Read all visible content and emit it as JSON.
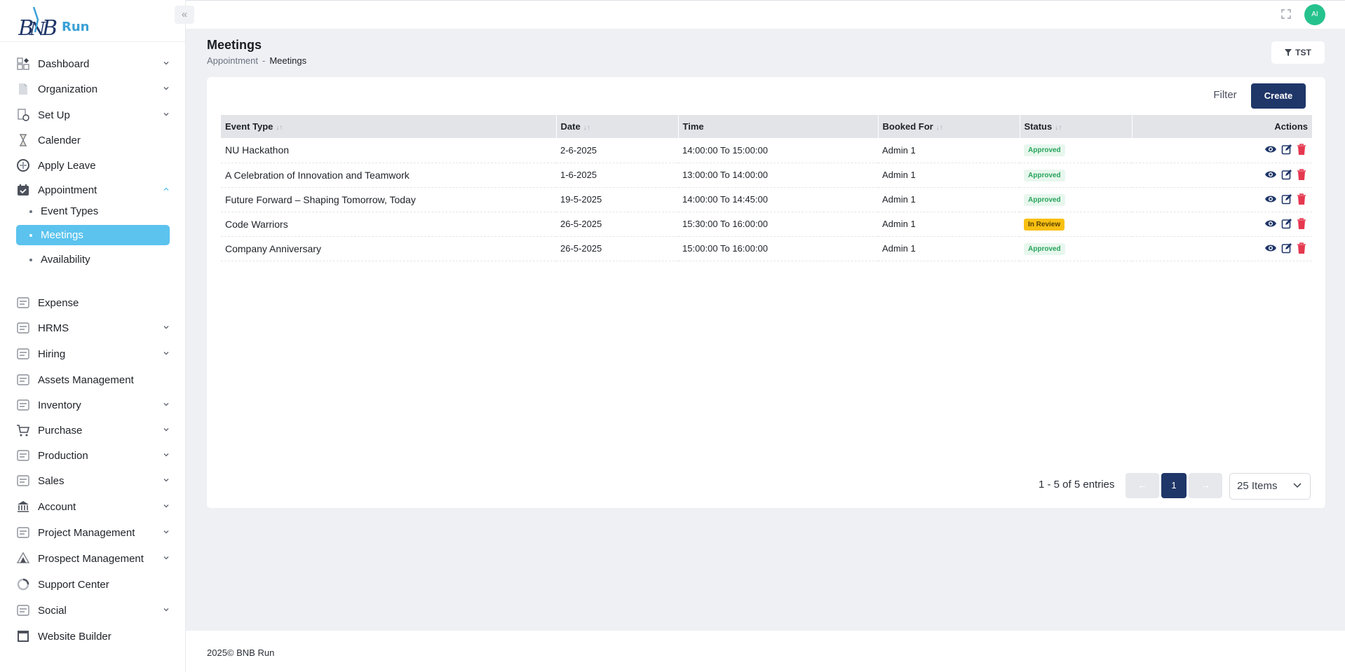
{
  "brand": {
    "name": "Run"
  },
  "sidebar": {
    "collapse_icon": "double-chevron-left-icon",
    "items": [
      {
        "label": "Dashboard",
        "icon": "dashboard-icon",
        "has_chevron": true
      },
      {
        "label": "Organization",
        "icon": "document-icon",
        "has_chevron": true
      },
      {
        "label": "Set Up",
        "icon": "setup-icon",
        "has_chevron": true
      },
      {
        "label": "Calender",
        "icon": "hourglass-icon",
        "has_chevron": false
      },
      {
        "label": "Apply Leave",
        "icon": "leave-icon",
        "has_chevron": false
      },
      {
        "label": "Appointment",
        "icon": "calendar-check-icon",
        "has_chevron": true,
        "expanded": true
      },
      {
        "label": "Expense",
        "icon": "expense-icon",
        "has_chevron": false
      },
      {
        "label": "HRMS",
        "icon": "hrms-icon",
        "has_chevron": true
      },
      {
        "label": "Hiring",
        "icon": "hiring-icon",
        "has_chevron": true
      },
      {
        "label": "Assets Management",
        "icon": "assets-icon",
        "has_chevron": false
      },
      {
        "label": "Inventory",
        "icon": "inventory-icon",
        "has_chevron": true
      },
      {
        "label": "Purchase",
        "icon": "cart-icon",
        "has_chevron": true
      },
      {
        "label": "Production",
        "icon": "production-icon",
        "has_chevron": true
      },
      {
        "label": "Sales",
        "icon": "sales-icon",
        "has_chevron": true
      },
      {
        "label": "Account",
        "icon": "bank-icon",
        "has_chevron": true
      },
      {
        "label": "Project Management",
        "icon": "project-icon",
        "has_chevron": true
      },
      {
        "label": "Prospect Management",
        "icon": "prospect-icon",
        "has_chevron": true
      },
      {
        "label": "Support Center",
        "icon": "support-icon",
        "has_chevron": false
      },
      {
        "label": "Social",
        "icon": "social-icon",
        "has_chevron": true
      },
      {
        "label": "Website Builder",
        "icon": "website-icon",
        "has_chevron": false
      }
    ],
    "sub_items": [
      {
        "label": "Event Types",
        "active": false
      },
      {
        "label": "Meetings",
        "active": true
      },
      {
        "label": "Availability",
        "active": false
      }
    ]
  },
  "header": {
    "avatar_initials": "AI",
    "fullscreen_icon": "fullscreen-icon"
  },
  "page": {
    "title": "Meetings",
    "breadcrumb": [
      "Appointment",
      "-",
      "Meetings"
    ],
    "tst_label": "TST"
  },
  "toolbar": {
    "filter_label": "Filter",
    "create_label": "Create"
  },
  "table": {
    "columns": [
      "Event Type",
      "Date",
      "Time",
      "Booked For",
      "Status",
      "Actions"
    ],
    "rows": [
      {
        "event": "NU Hackathon",
        "date": "2-6-2025",
        "time": "14:00:00 To 15:00:00",
        "booked_for": "Admin 1",
        "status": "Approved"
      },
      {
        "event": "A Celebration of Innovation and Teamwork",
        "date": "1-6-2025",
        "time": "13:00:00 To 14:00:00",
        "booked_for": "Admin 1",
        "status": "Approved"
      },
      {
        "event": "Future Forward – Shaping Tomorrow, Today",
        "date": "19-5-2025",
        "time": "14:00:00 To 14:45:00",
        "booked_for": "Admin 1",
        "status": "Approved"
      },
      {
        "event": "Code Warriors",
        "date": "26-5-2025",
        "time": "15:30:00 To 16:00:00",
        "booked_for": "Admin 1",
        "status": "In Review"
      },
      {
        "event": "Company Anniversary",
        "date": "26-5-2025",
        "time": "15:00:00 To 16:00:00",
        "booked_for": "Admin 1",
        "status": "Approved"
      }
    ]
  },
  "pagination": {
    "summary": "1 - 5 of 5 entries",
    "prev": "←",
    "current_page": "1",
    "next": "→",
    "per_page": "25 Items"
  },
  "footer": {
    "text": "2025© BNB Run"
  },
  "colors": {
    "primary": "#1f3668",
    "active_nav": "#5bc3ee",
    "approved": "#27a35b",
    "in_review": "#f8c012",
    "delete": "#e53950"
  }
}
